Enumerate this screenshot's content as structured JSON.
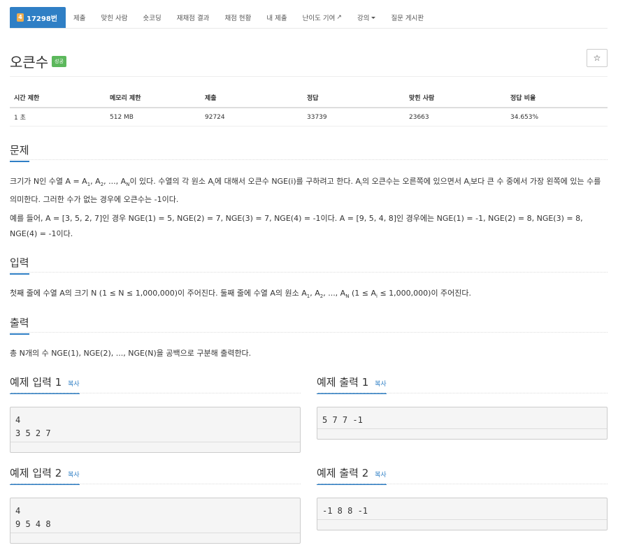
{
  "nav": {
    "problem_number": "17298번",
    "badge_icon": "tier-badge-icon",
    "tabs": [
      "제출",
      "맞힌 사람",
      "숏코딩",
      "재채점 결과",
      "채점 현황",
      "내 제출"
    ],
    "difficulty": "난이도 기여",
    "lecture": "강의",
    "board": "질문 게시판"
  },
  "problem": {
    "title": "오큰수",
    "status": "성공",
    "star": "☆"
  },
  "info": {
    "headers": [
      "시간 제한",
      "메모리 제한",
      "제출",
      "정답",
      "맞힌 사람",
      "정답 비율"
    ],
    "values": [
      "1 초",
      "512 MB",
      "92724",
      "33739",
      "23663",
      "34.653%"
    ]
  },
  "sections": {
    "description_title": "문제",
    "desc_p1_a": "크기가 N인 수열 A = A",
    "desc_p1_b": ", A",
    "desc_p1_c": ", ..., A",
    "desc_p1_d": "이 있다. 수열의 각 원소 A",
    "desc_p1_e": "에 대해서 오큰수 NGE(i)를 구하려고 한다. A",
    "desc_p1_f": "의 오큰수는 오른쪽에 있으면서 A",
    "desc_p1_g": "보다 큰 수 중에서 가장 왼쪽에 있는 수를 의미한다. 그러한 수가 없는 경우에 오큰수는 -1이다.",
    "desc_p2": "예를 들어, A = [3, 5, 2, 7]인 경우 NGE(1) = 5, NGE(2) = 7, NGE(3) = 7, NGE(4) = -1이다. A = [9, 5, 4, 8]인 경우에는 NGE(1) = -1, NGE(2) = 8, NGE(3) = 8, NGE(4) = -1이다.",
    "sub_1": "1",
    "sub_2": "2",
    "sub_N": "N",
    "sub_i": "i",
    "input_title": "입력",
    "input_a": "첫째 줄에 수열 A의 크기 N (1 ≤ N ≤ 1,000,000)이 주어진다. 둘째 줄에 수열 A의 원소 A",
    "input_b": ", A",
    "input_c": ", ..., A",
    "input_d": " (1 ≤ A",
    "input_e": " ≤ 1,000,000)이 주어진다.",
    "output_title": "출력",
    "output_text": "총 N개의 수 NGE(1), NGE(2), ..., NGE(N)을 공백으로 구분해 출력한다."
  },
  "samples": {
    "copy": "복사",
    "in1_title": "예제 입력 1",
    "out1_title": "예제 출력 1",
    "in2_title": "예제 입력 2",
    "out2_title": "예제 출력 2",
    "in1": "4\n3 5 2 7",
    "out1": "5 7 7 -1",
    "in2": "4\n9 5 4 8",
    "out2": "-1 8 8 -1"
  }
}
